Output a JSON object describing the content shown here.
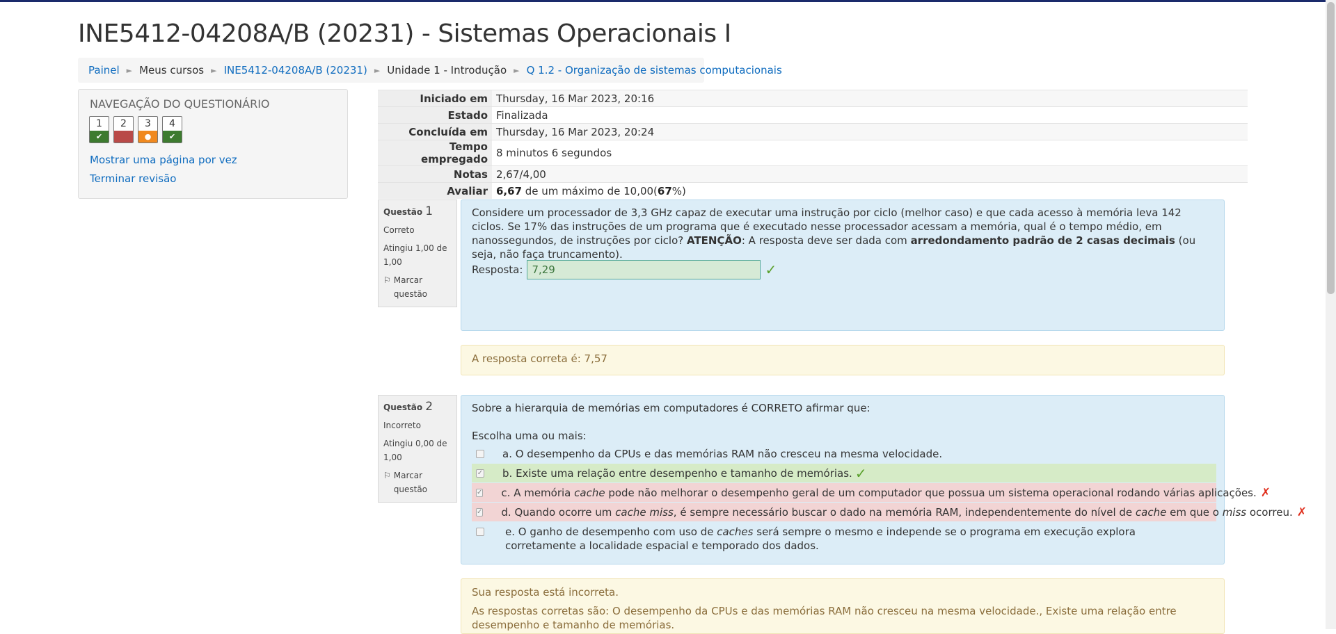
{
  "page": {
    "title": "INE5412-04208A/B (20231) - Sistemas Operacionais I"
  },
  "breadcrumb": [
    {
      "label": "Painel",
      "link": true
    },
    {
      "label": "Meus cursos",
      "link": false
    },
    {
      "label": "INE5412-04208A/B (20231)",
      "link": true
    },
    {
      "label": "Unidade 1 - Introdução",
      "link": false
    },
    {
      "label": "Q 1.2 - Organização de sistemas computacionais",
      "link": true
    }
  ],
  "quiz_nav": {
    "title": "Navegação do questionário",
    "questions": [
      {
        "num": "1",
        "state": "correct"
      },
      {
        "num": "2",
        "state": "incorrect"
      },
      {
        "num": "3",
        "state": "partial"
      },
      {
        "num": "4",
        "state": "correct"
      }
    ],
    "show_one_page": "Mostrar uma página por vez",
    "finish_review": "Terminar revisão"
  },
  "summary": [
    {
      "label": "Iniciado em",
      "value": "Thursday, 16 Mar 2023, 20:16"
    },
    {
      "label": "Estado",
      "value": "Finalizada"
    },
    {
      "label": "Concluída em",
      "value": "Thursday, 16 Mar 2023, 20:24"
    },
    {
      "label": "Tempo empregado",
      "value": "8 minutos 6 segundos"
    },
    {
      "label": "Notas",
      "value": "2,67/4,00"
    },
    {
      "label": "Avaliar",
      "grade": "6,67",
      "grade_mid": " de um máximo de 10,00(",
      "pct": "67",
      "pct_end": "%)"
    }
  ],
  "q1": {
    "label": "Questão",
    "number": "1",
    "status": "Correto",
    "score": "Atingiu 1,00 de 1,00",
    "flag": "Marcar questão",
    "text_a": "Considere um processador de 3,3 GHz capaz de executar uma instrução por ciclo (melhor caso) e que cada acesso à memória leva 142 ciclos. Se 17% das instruções de um programa que é executado nesse processador acessam a memória, qual é o tempo médio, em nanossegundos, de instruções por ciclo? ",
    "text_b": "ATENÇÃO",
    "text_c": ": A resposta deve ser dada com ",
    "text_d": "arredondamento padrão de 2 casas decimais",
    "text_e": " (ou seja, não faça truncamento).",
    "answer_label": "Resposta:",
    "answer_value": "7,29",
    "feedback": "A resposta correta é: 7,57"
  },
  "q2": {
    "label": "Questão",
    "number": "2",
    "status": "Incorreto",
    "score": "Atingiu 0,00 de 1,00",
    "flag": "Marcar questão",
    "text": "Sobre a hierarquia de memórias em computadores é CORRETO afirmar que:",
    "prompt": "Escolha uma ou mais:",
    "options": {
      "a": {
        "letter": "a. ",
        "t1": "O desempenho da CPUs e das memórias RAM não cresceu na mesma velocidade."
      },
      "b": {
        "letter": "b. ",
        "t1": "Existe uma relação entre desempenho e tamanho de memórias."
      },
      "c": {
        "letter": "c. ",
        "t1": "A memória ",
        "i1": "cache",
        "t2": " pode não melhorar o desempenho geral de um computador que possua um sistema operacional rodando várias aplicações."
      },
      "d": {
        "letter": "d. ",
        "t1": "Quando ocorre um ",
        "i1": "cache miss",
        "t2": ", é sempre necessário buscar o dado na memória RAM, independentemente do nível de ",
        "i2": "cache",
        "t3": " em que o ",
        "i3": "miss",
        "t4": " ocorreu."
      },
      "e": {
        "letter": "e. ",
        "t1": "O ganho de desempenho com uso de ",
        "i1": "caches",
        "t2": " será sempre o mesmo e independe se o programa em execução explora corretamente a localidade espacial e temporado dos dados."
      }
    },
    "feedback_1": "Sua resposta está incorreta.",
    "feedback_2": "As respostas corretas são: O desempenho da CPUs e das memórias RAM não cresceu na mesma velocidade., Existe uma relação entre desempenho e tamanho de memórias."
  }
}
